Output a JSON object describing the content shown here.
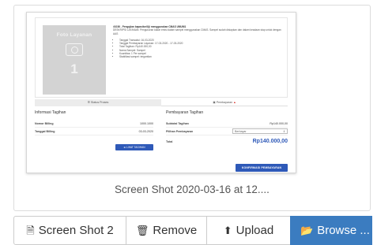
{
  "preview": {
    "caption": "Screen Shot 2020-03-16 at 12....",
    "photo_title": "Foto Layanan",
    "photo_number": "1",
    "info_title": "#1036 - Pengujian kapasitor/Uji menggunakan CMAS UMUM1",
    "info_desc": "DESKRIPSI LAYANAN: Pengukuran kadar emisi dalam sampel menggunakan CMAS. Sampel sudah disiapkan dan dalam keadaan siap untuk dengan AAS",
    "info_items": [
      "Tanggal Transaksi: 16-03-2020",
      "Tanggal Pembayaran Layanan: 17-03-2020 - 17-03-2020",
      "Total Tagihan: Rp140.000,00",
      "Nama Sampel: Sampel",
      "Kuantitas: 1 Per sampel",
      "Stabilitasi sampel: tergantian"
    ],
    "tab_status": "Status Proses",
    "tab_payment": "Pembayaran",
    "left_head": "Informasi Tagihan",
    "left_rows": [
      {
        "k": "Nomor Billing",
        "v": "1000.1000"
      },
      {
        "k": "Tanggal Billing",
        "v": "03-03-2020"
      }
    ],
    "left_button": "LIHAT TAGIHAN",
    "right_head": "Pembayaran Tagihan",
    "subtotal_label": "Subtotal Tagihan",
    "subtotal_value": "Rp140.000,00",
    "method_label": "Pilihan Pembayaran",
    "method_value": "Berbayar",
    "total_label": "Total",
    "total_value": "Rp140.000,00",
    "confirm_button": "KONFIRMASI PEMBAYARAN"
  },
  "actions": {
    "filename": "Screen Shot 2",
    "remove": "Remove",
    "upload": "Upload",
    "browse": "Browse ..."
  },
  "icons": {
    "file": "file-icon",
    "trash": "trash-icon",
    "upload": "upload-circle-icon",
    "folder": "folder-open-icon"
  },
  "colors": {
    "accent": "#3b7cc0",
    "inner_button": "#2e59b8"
  }
}
